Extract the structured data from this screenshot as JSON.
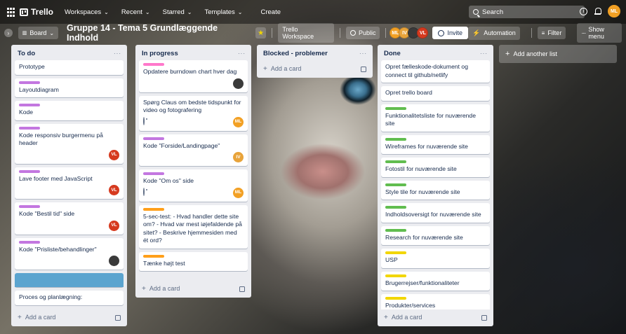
{
  "header": {
    "logo": "Trello",
    "nav": [
      {
        "label": "Workspaces",
        "name": "nav-workspaces"
      },
      {
        "label": "Recent",
        "name": "nav-recent"
      },
      {
        "label": "Starred",
        "name": "nav-starred"
      },
      {
        "label": "Templates",
        "name": "nav-templates"
      }
    ],
    "create_label": "Create",
    "search_placeholder": "Search",
    "user_initials": "ML",
    "user_color": "#f2a024"
  },
  "board": {
    "view_label": "Board",
    "title": "Gruppe 14 - Tema 5 Grundlæggende Indhold",
    "workspace_label": "Trello Workspace",
    "visibility_label": "Public",
    "members": [
      {
        "initials": "ML",
        "color": "#f2a024"
      },
      {
        "initials": "IV",
        "color": "#e8a33a"
      },
      {
        "initials": "",
        "color": "#3a3a3a"
      },
      {
        "initials": "VL",
        "color": "#d63a1f"
      }
    ],
    "invite_label": "Invite",
    "automation_label": "Automation",
    "filter_label": "Filter",
    "menu_label": "Show menu"
  },
  "lists": [
    {
      "title": "To do",
      "add_card": "Add a card",
      "cards": [
        {
          "text": "Prototype",
          "label": null
        },
        {
          "text": "Layoutdiagram",
          "label": "#c377e0"
        },
        {
          "text": "Kode",
          "label": "#c377e0"
        },
        {
          "text": "Kode responsiv burgermenu på header",
          "label": "#c377e0",
          "member": {
            "initials": "VL",
            "color": "#d63a1f"
          }
        },
        {
          "text": "Lave footer med JavaScript",
          "label": "#c377e0",
          "member": {
            "initials": "VL",
            "color": "#d63a1f"
          }
        },
        {
          "text": "Kode \"Bestil tid\" side",
          "label": "#c377e0",
          "member": {
            "initials": "VL",
            "color": "#d63a1f"
          }
        },
        {
          "text": "Kode \"Prisliste/behandlinger\"",
          "label": "#c377e0",
          "member": {
            "initials": "",
            "color": "#3a3a3a"
          }
        },
        {
          "text": "",
          "cover": "#5ba4cf"
        },
        {
          "text": "Proces og planlægning:",
          "label": null
        }
      ]
    },
    {
      "title": "In progress",
      "add_card": "Add a card",
      "cards": [
        {
          "text": "Opdatere burndown chart hver dag",
          "label": "#ff78cb",
          "member": {
            "initials": "",
            "color": "#3a3a3a"
          }
        },
        {
          "text": "Spørg Claus om bedste tidspunkt for video og fotografering",
          "label": null,
          "watch": true,
          "member": {
            "initials": "ML",
            "color": "#f2a024"
          }
        },
        {
          "text": "Kode \"Forside/Landingpage\"",
          "label": "#c377e0",
          "member": {
            "initials": "IV",
            "color": "#e8a33a"
          }
        },
        {
          "text": "Kode \"Om os\" side",
          "label": "#c377e0",
          "watch": true,
          "member": {
            "initials": "ML",
            "color": "#f2a024"
          }
        },
        {
          "text": "5-sec-test: - Hvad handler dette site om? - Hvad var mest iøjefaldende på sitet? - Beskrive hjemmesiden med ét ord?",
          "label": "#ff9f1a"
        },
        {
          "text": "Tænke højt test",
          "label": "#ff9f1a"
        }
      ]
    },
    {
      "title": "Blocked - problemer",
      "add_card": "Add a card",
      "cards": []
    },
    {
      "title": "Done",
      "add_card": "Add a card",
      "cards": [
        {
          "text": "Opret fælleskode-dokument og connect til github/netlify",
          "label": null
        },
        {
          "text": "Opret trello board",
          "label": null
        },
        {
          "text": "Funktionalitetsliste for nuværende site",
          "label": "#61bd4f"
        },
        {
          "text": "Wireframes for nuværende site",
          "label": "#61bd4f"
        },
        {
          "text": "Fotostil for nuværende site",
          "label": "#61bd4f"
        },
        {
          "text": "Style tile for nuværende site",
          "label": "#61bd4f"
        },
        {
          "text": "Indholdsoversigt for nuværende site",
          "label": "#61bd4f"
        },
        {
          "text": "Research for nuværende site",
          "label": "#61bd4f"
        },
        {
          "text": "USP",
          "label": "#f2d600"
        },
        {
          "text": "Brugerrejser/funktionaliteter",
          "label": "#f2d600"
        },
        {
          "text": "Produkter/services",
          "label": "#f2d600"
        }
      ]
    }
  ],
  "add_list_label": "Add another list"
}
